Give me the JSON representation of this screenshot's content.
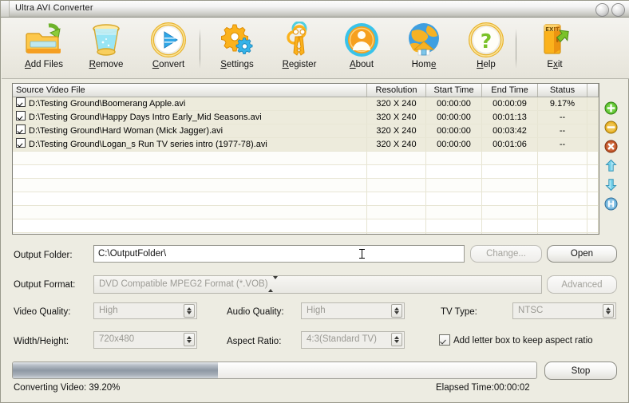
{
  "window": {
    "title": "Ultra AVI Converter",
    "buttons": [
      "minimize-button",
      "maximize-button"
    ]
  },
  "toolbar": {
    "items": [
      {
        "name": "add-files",
        "label_pre": "A",
        "label_key": "d",
        "label_post": "d Files",
        "label": "Add Files",
        "icon": "folder-add-icon"
      },
      {
        "name": "remove",
        "label": "Remove",
        "icon": "trash-bin-icon"
      },
      {
        "name": "convert",
        "label": "Convert",
        "icon": "play-circle-icon"
      },
      {
        "name": "settings",
        "label": "Settings",
        "icon": "gears-icon"
      },
      {
        "name": "register",
        "label": "Register",
        "icon": "keys-icon"
      },
      {
        "name": "about",
        "label": "About",
        "icon": "user-circle-icon"
      },
      {
        "name": "home",
        "label": "Home",
        "icon": "globe-house-icon"
      },
      {
        "name": "help",
        "label": "Help",
        "icon": "question-circle-icon"
      },
      {
        "name": "exit",
        "label": "Exit",
        "icon": "exit-door-icon"
      }
    ]
  },
  "filelist": {
    "columns": [
      "Source Video File",
      "Resolution",
      "Start Time",
      "End Time",
      "Status"
    ],
    "rows": [
      {
        "checked": true,
        "file": "D:\\Testing Ground\\Boomerang Apple.avi",
        "resolution": "320 X 240",
        "start": "00:00:00",
        "end": "00:00:09",
        "status": "9.17%"
      },
      {
        "checked": true,
        "file": "D:\\Testing Ground\\Happy Days Intro Early_Mid Seasons.avi",
        "resolution": "320 X 240",
        "start": "00:00:00",
        "end": "00:01:13",
        "status": "--"
      },
      {
        "checked": true,
        "file": "D:\\Testing Ground\\Hard Woman (Mick Jagger).avi",
        "resolution": "320 X 240",
        "start": "00:00:00",
        "end": "00:03:42",
        "status": "--"
      },
      {
        "checked": true,
        "file": "D:\\Testing Ground\\Logan_s Run TV series intro (1977-78).avi",
        "resolution": "320 X 240",
        "start": "00:00:00",
        "end": "00:01:06",
        "status": "--"
      }
    ]
  },
  "sidebuttons": [
    {
      "name": "add-item-button",
      "icon": "plus-circle-icon",
      "color": "#4caf2a"
    },
    {
      "name": "remove-item-button",
      "icon": "minus-circle-icon",
      "color": "#e0a81a"
    },
    {
      "name": "clear-all-button",
      "icon": "x-circle-icon",
      "color": "#c0522a"
    },
    {
      "name": "move-up-button",
      "icon": "arrow-up-icon",
      "color": "#63c8e0"
    },
    {
      "name": "move-down-button",
      "icon": "arrow-down-icon",
      "color": "#63c8e0"
    },
    {
      "name": "merge-button",
      "icon": "merge-circle-icon",
      "color": "#63a8d8"
    }
  ],
  "form": {
    "output_folder_label": "Output Folder:",
    "output_folder_value": "C:\\OutputFolder\\",
    "change_button": "Change...",
    "open_button": "Open",
    "output_format_label": "Output Format:",
    "output_format_value": "DVD Compatible MPEG2 Format (*.VOB)",
    "advanced_button": "Advanced",
    "video_quality_label": "Video Quality:",
    "video_quality_value": "High",
    "audio_quality_label": "Audio Quality:",
    "audio_quality_value": "High",
    "tv_type_label": "TV Type:",
    "tv_type_value": "NTSC",
    "width_height_label": "Width/Height:",
    "width_height_value": "720x480",
    "aspect_ratio_label": "Aspect Ratio:",
    "aspect_ratio_value": "4:3(Standard TV)",
    "letterbox_label": "Add letter box to keep aspect ratio",
    "letterbox_checked": true
  },
  "status": {
    "progress_percent": 39.2,
    "progress_text": "Converting Video: 39.20%",
    "elapsed_text": "Elapsed Time:00:00:02",
    "stop_button": "Stop"
  }
}
